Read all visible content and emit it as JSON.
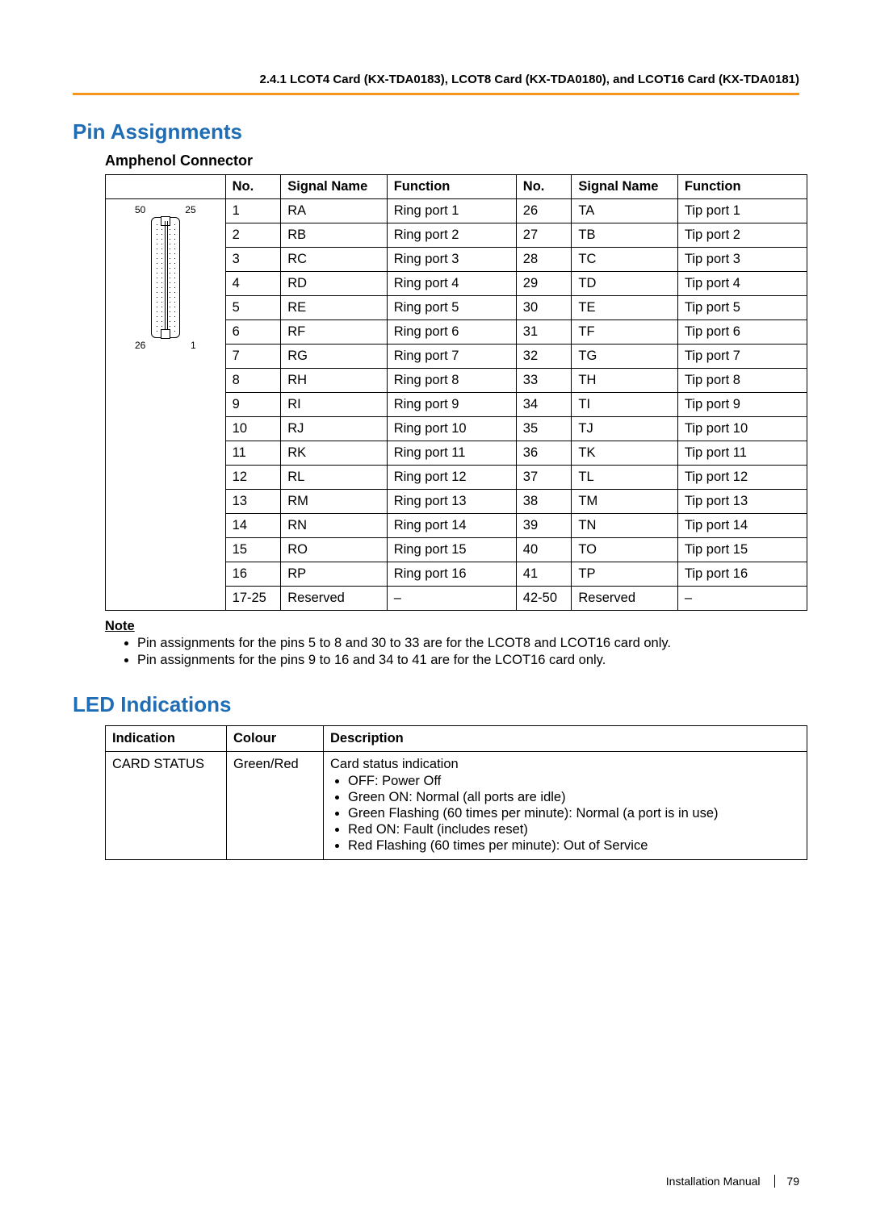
{
  "header": "2.4.1 LCOT4 Card (KX-TDA0183), LCOT8 Card (KX-TDA0180), and LCOT16 Card (KX-TDA0181)",
  "section1_title": "Pin Assignments",
  "amphenol_title": "Amphenol Connector",
  "pin_headers": {
    "no1": "No.",
    "sig1": "Signal Name",
    "fn1": "Function",
    "no2": "No.",
    "sig2": "Signal Name",
    "fn2": "Function"
  },
  "connector_labels": {
    "tl": "50",
    "tr": "25",
    "bl": "26",
    "br": "1"
  },
  "pin_rows": [
    {
      "n1": "1",
      "s1": "RA",
      "f1": "Ring port 1",
      "n2": "26",
      "s2": "TA",
      "f2": "Tip port 1"
    },
    {
      "n1": "2",
      "s1": "RB",
      "f1": "Ring port 2",
      "n2": "27",
      "s2": "TB",
      "f2": "Tip port 2"
    },
    {
      "n1": "3",
      "s1": "RC",
      "f1": "Ring port 3",
      "n2": "28",
      "s2": "TC",
      "f2": "Tip port 3"
    },
    {
      "n1": "4",
      "s1": "RD",
      "f1": "Ring port 4",
      "n2": "29",
      "s2": "TD",
      "f2": "Tip port 4"
    },
    {
      "n1": "5",
      "s1": "RE",
      "f1": "Ring port 5",
      "n2": "30",
      "s2": "TE",
      "f2": "Tip port 5"
    },
    {
      "n1": "6",
      "s1": "RF",
      "f1": "Ring port 6",
      "n2": "31",
      "s2": "TF",
      "f2": "Tip port 6"
    },
    {
      "n1": "7",
      "s1": "RG",
      "f1": "Ring port 7",
      "n2": "32",
      "s2": "TG",
      "f2": "Tip port 7"
    },
    {
      "n1": "8",
      "s1": "RH",
      "f1": "Ring port 8",
      "n2": "33",
      "s2": "TH",
      "f2": "Tip port 8"
    },
    {
      "n1": "9",
      "s1": "RI",
      "f1": "Ring port 9",
      "n2": "34",
      "s2": "TI",
      "f2": "Tip port 9"
    },
    {
      "n1": "10",
      "s1": "RJ",
      "f1": "Ring port 10",
      "n2": "35",
      "s2": "TJ",
      "f2": "Tip port 10"
    },
    {
      "n1": "11",
      "s1": "RK",
      "f1": "Ring port 11",
      "n2": "36",
      "s2": "TK",
      "f2": "Tip port 11"
    },
    {
      "n1": "12",
      "s1": "RL",
      "f1": "Ring port 12",
      "n2": "37",
      "s2": "TL",
      "f2": "Tip port 12"
    },
    {
      "n1": "13",
      "s1": "RM",
      "f1": "Ring port 13",
      "n2": "38",
      "s2": "TM",
      "f2": "Tip port 13"
    },
    {
      "n1": "14",
      "s1": "RN",
      "f1": "Ring port 14",
      "n2": "39",
      "s2": "TN",
      "f2": "Tip port 14"
    },
    {
      "n1": "15",
      "s1": "RO",
      "f1": "Ring port 15",
      "n2": "40",
      "s2": "TO",
      "f2": "Tip port 15"
    },
    {
      "n1": "16",
      "s1": "RP",
      "f1": "Ring port 16",
      "n2": "41",
      "s2": "TP",
      "f2": "Tip port 16"
    },
    {
      "n1": "17-25",
      "s1": "Reserved",
      "f1": "–",
      "n2": "42-50",
      "s2": "Reserved",
      "f2": "–"
    }
  ],
  "note_label": "Note",
  "notes": [
    "Pin assignments for the pins 5 to 8 and 30 to 33 are for the LCOT8 and LCOT16 card only.",
    "Pin assignments for the pins 9 to 16 and 34 to 41 are for the LCOT16 card only."
  ],
  "section2_title": "LED Indications",
  "led_headers": {
    "ind": "Indication",
    "col": "Colour",
    "desc": "Description"
  },
  "led_row": {
    "indication": "CARD STATUS",
    "colour": "Green/Red",
    "desc_lead": "Card status indication",
    "items": [
      "OFF: Power Off",
      "Green ON: Normal (all ports are idle)",
      "Green Flashing (60 times per minute): Normal (a port is in use)",
      "Red ON: Fault (includes reset)",
      "Red Flashing (60 times per minute): Out of Service"
    ]
  },
  "footer": {
    "manual": "Installation Manual",
    "page": "79"
  }
}
